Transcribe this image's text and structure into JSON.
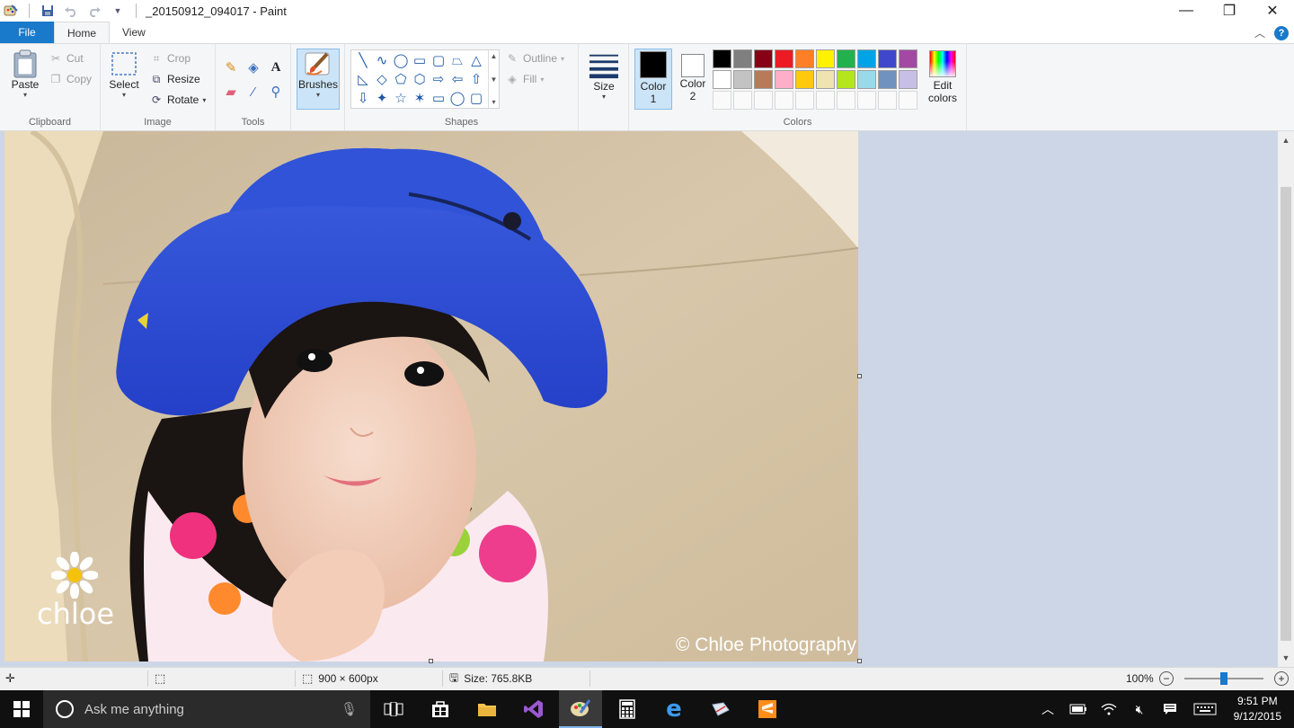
{
  "titlebar": {
    "title": "_20150912_094017 - Paint",
    "minimize": "—",
    "restore": "❐",
    "close": "✕"
  },
  "tabs": [
    "File",
    "Home",
    "View"
  ],
  "clipboard": {
    "paste": "Paste",
    "cut": "Cut",
    "copy": "Copy",
    "label": "Clipboard"
  },
  "image": {
    "select": "Select",
    "crop": "Crop",
    "resize": "Resize",
    "rotate": "Rotate",
    "label": "Image"
  },
  "tools": {
    "label": "Tools"
  },
  "brushes": {
    "label": "Brushes"
  },
  "shapes": {
    "outline": "Outline",
    "fill": "Fill",
    "label": "Shapes",
    "glyphs": [
      "╲",
      "∿",
      "◯",
      "▭",
      "▢",
      "⏢",
      "△",
      "◺",
      "◇",
      "⬠",
      "⬡",
      "⇨",
      "⇦",
      "⇧",
      "⇩",
      "✦",
      "☆",
      "✶",
      "▭",
      "◯",
      "▢"
    ]
  },
  "size": {
    "label": "Size"
  },
  "colors": {
    "color1_line1": "Color",
    "color1_line2": "1",
    "color2_line1": "Color",
    "color2_line2": "2",
    "label": "Colors",
    "edit_line1": "Edit",
    "edit_line2": "colors",
    "color1": "#000000",
    "color2": "#ffffff",
    "palette_row1": [
      "#000000",
      "#7f7f7f",
      "#880015",
      "#ed1c24",
      "#ff7f27",
      "#fff200",
      "#22b14c",
      "#00a2e8",
      "#3f48cc",
      "#a349a4"
    ],
    "palette_row2": [
      "#ffffff",
      "#c3c3c3",
      "#b97a57",
      "#ffaec9",
      "#ffc90e",
      "#efe4b0",
      "#b5e61d",
      "#99d9ea",
      "#7092be",
      "#c8bfe7"
    ]
  },
  "canvas": {
    "watermark_name": "chloe",
    "watermark_credit": "© Chloe Photography"
  },
  "status": {
    "dimensions": "900 × 600px",
    "size": "Size: 765.8KB",
    "zoom": "100%",
    "zoom_level": 0.5
  },
  "taskbar": {
    "search_placeholder": "Ask me anything",
    "time": "9:51 PM",
    "date": "9/12/2015"
  }
}
